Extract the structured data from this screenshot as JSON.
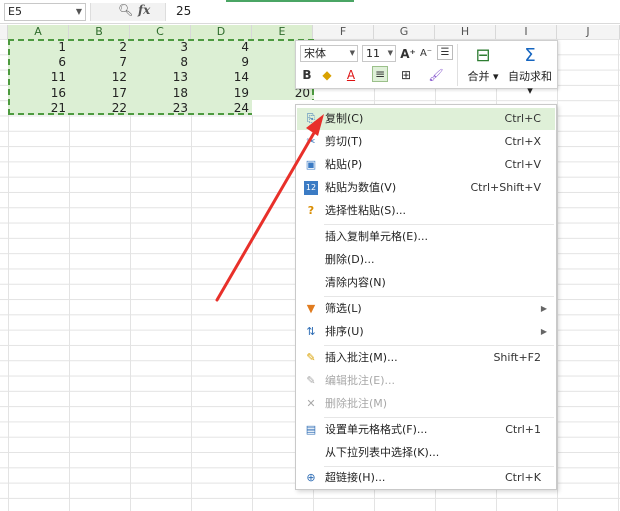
{
  "formula_bar": {
    "name_box": "E5",
    "zoom_icon": "magnifier-icon",
    "fx_label": "fx",
    "value": "25"
  },
  "columns": [
    "A",
    "B",
    "C",
    "D",
    "E",
    "F",
    "G",
    "H",
    "I",
    "J"
  ],
  "rows": [
    [
      "1",
      "2",
      "3",
      "4",
      ""
    ],
    [
      "6",
      "7",
      "8",
      "9",
      ""
    ],
    [
      "11",
      "12",
      "13",
      "14",
      ""
    ],
    [
      "16",
      "17",
      "18",
      "19",
      "20"
    ],
    [
      "21",
      "22",
      "23",
      "24",
      ""
    ]
  ],
  "mini_toolbar": {
    "font": "宋体",
    "size": "11",
    "grow": "A⁺",
    "shrink": "A⁻",
    "bold": "B",
    "font_color": "A",
    "merge_label": "合并",
    "autosum_label": "自动求和",
    "sigma": "Σ"
  },
  "context_menu": {
    "items": [
      {
        "label": "复制(C)",
        "shortcut": "Ctrl+C",
        "icon": "copy-icon",
        "glyph": "⎘"
      },
      {
        "label": "剪切(T)",
        "shortcut": "Ctrl+X",
        "icon": "scissors-icon",
        "glyph": "✂"
      },
      {
        "label": "粘贴(P)",
        "shortcut": "Ctrl+V",
        "icon": "paste-icon",
        "glyph": "📋"
      },
      {
        "label": "粘贴为数值(V)",
        "shortcut": "Ctrl+Shift+V",
        "icon": "paste-values-icon",
        "glyph": "12"
      },
      {
        "label": "选择性粘贴(S)...",
        "shortcut": "",
        "icon": "paste-special-icon",
        "glyph": "?"
      },
      {
        "label": "插入复制单元格(E)...",
        "shortcut": ""
      },
      {
        "label": "删除(D)...",
        "shortcut": ""
      },
      {
        "label": "清除内容(N)",
        "shortcut": ""
      },
      {
        "label": "筛选(L)",
        "shortcut": "",
        "icon": "filter-icon",
        "glyph": "▼"
      },
      {
        "label": "排序(U)",
        "shortcut": "",
        "icon": "sort-icon",
        "glyph": "⇅"
      },
      {
        "label": "插入批注(M)...",
        "shortcut": "Shift+F2",
        "icon": "comment-icon",
        "glyph": "✎"
      },
      {
        "label": "编辑批注(E)...",
        "shortcut": "",
        "icon": "edit-comment-icon",
        "glyph": "✎"
      },
      {
        "label": "删除批注(M)",
        "shortcut": "",
        "icon": "delete-comment-icon",
        "glyph": "✕"
      },
      {
        "label": "设置单元格格式(F)...",
        "shortcut": "Ctrl+1",
        "icon": "format-cells-icon",
        "glyph": "▤"
      },
      {
        "label": "从下拉列表中选择(K)...",
        "shortcut": ""
      },
      {
        "label": "超链接(H)...",
        "shortcut": "Ctrl+K",
        "icon": "hyperlink-icon",
        "glyph": "🔗"
      }
    ]
  },
  "colors": {
    "selection_fill": "#dcefd4",
    "selection_border": "#4d9a3f",
    "highlight": "#dff0d8",
    "arrow": "#e8302a"
  }
}
